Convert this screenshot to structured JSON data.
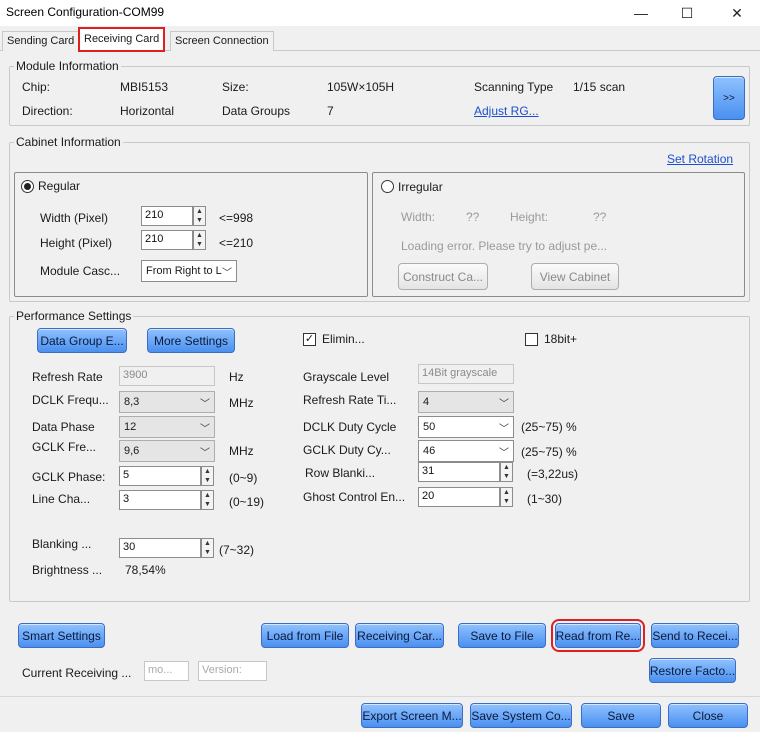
{
  "window": {
    "title": "Screen Configuration-COM99",
    "minimize": "—",
    "maximize": "☐",
    "close": "✕"
  },
  "tabs": [
    {
      "label": "Sending Card"
    },
    {
      "label": "Receiving Card"
    },
    {
      "label": "Screen Connection"
    }
  ],
  "module": {
    "group_label": "Module Information",
    "chip_label": "Chip:",
    "chip_value": "MBI5153",
    "size_label": "Size:",
    "size_value": "105W×105H",
    "scan_label": "Scanning Type",
    "scan_value": "1/15 scan",
    "direction_label": "Direction:",
    "direction_value": "Horizontal",
    "groups_label": "Data Groups",
    "groups_value": "7",
    "adjust_link": "Adjust RG...",
    "more_button": ">>"
  },
  "cabinet": {
    "group_label": "Cabinet Information",
    "set_rotation": "Set Rotation",
    "regular_label": "Regular",
    "width_label": "Width (Pixel)",
    "width_value": "210",
    "width_limit": "<=998",
    "height_label": "Height (Pixel)",
    "height_value": "210",
    "height_limit": "<=210",
    "cascade_label": "Module Casc...",
    "cascade_value": "From Right to L",
    "irregular_label": "Irregular",
    "irr_width_label": "Width:",
    "irr_width_value": "??",
    "irr_height_label": "Height:",
    "irr_height_value": "??",
    "loading_error": "Loading error. Please try to adjust pe...",
    "construct_button": "Construct Ca...",
    "view_button": "View Cabinet"
  },
  "performance": {
    "group_label": "Performance Settings",
    "data_group_button": "Data Group E...",
    "more_settings_button": "More Settings",
    "elimin_label": "Elimin...",
    "bit18_label": "18bit+",
    "refresh_label": "Refresh Rate",
    "refresh_value": "3900",
    "refresh_unit": "Hz",
    "dclk_freq_label": "DCLK Frequ...",
    "dclk_freq_value": "8,3",
    "dclk_freq_unit": "MHz",
    "data_phase_label": "Data Phase",
    "data_phase_value": "12",
    "gclk_freq_label": "GCLK Fre...",
    "gclk_freq_value": "9,6",
    "gclk_freq_unit": "MHz",
    "gclk_phase_label": "GCLK Phase:",
    "gclk_phase_value": "5",
    "gclk_phase_range": "(0~9)",
    "line_cha_label": "Line Cha...",
    "line_cha_value": "3",
    "line_cha_range": "(0~19)",
    "blanking_label": "Blanking ...",
    "blanking_value": "30",
    "blanking_range": "(7~32)",
    "brightness_label": "Brightness ...",
    "brightness_value": "78,54%",
    "grayscale_label": "Grayscale Level",
    "grayscale_value": "14Bit grayscale",
    "refresh_times_label": "Refresh Rate Ti...",
    "refresh_times_value": "4",
    "dclk_duty_label": "DCLK Duty Cycle",
    "dclk_duty_value": "50",
    "dclk_duty_range": "(25~75) %",
    "gclk_duty_label": "GCLK Duty Cy...",
    "gclk_duty_value": "46",
    "gclk_duty_range": "(25~75) %",
    "row_blank_label": "Row Blanki...",
    "row_blank_value": "31",
    "row_blank_note": "(=3,22us)",
    "ghost_label": "Ghost Control En...",
    "ghost_value": "20",
    "ghost_range": "(1~30)"
  },
  "actions": {
    "smart_settings": "Smart Settings",
    "load_from_file": "Load from File",
    "receiving_car": "Receiving Car...",
    "save_to_file": "Save to File",
    "read_from_re": "Read from Re...",
    "send_to_recei": "Send to Recei...",
    "restore_facto": "Restore Facto...",
    "current_receiving_label": "Current Receiving ...",
    "current_model_placeholder": "mo...",
    "version_placeholder": "Version:"
  },
  "footer": {
    "export_screen": "Export Screen M...",
    "save_system": "Save System Co...",
    "save": "Save",
    "close": "Close"
  },
  "colors": {
    "accent_blue": "#4a90f0",
    "highlight_red": "#e02020",
    "link_blue": "#1e4fd0"
  }
}
